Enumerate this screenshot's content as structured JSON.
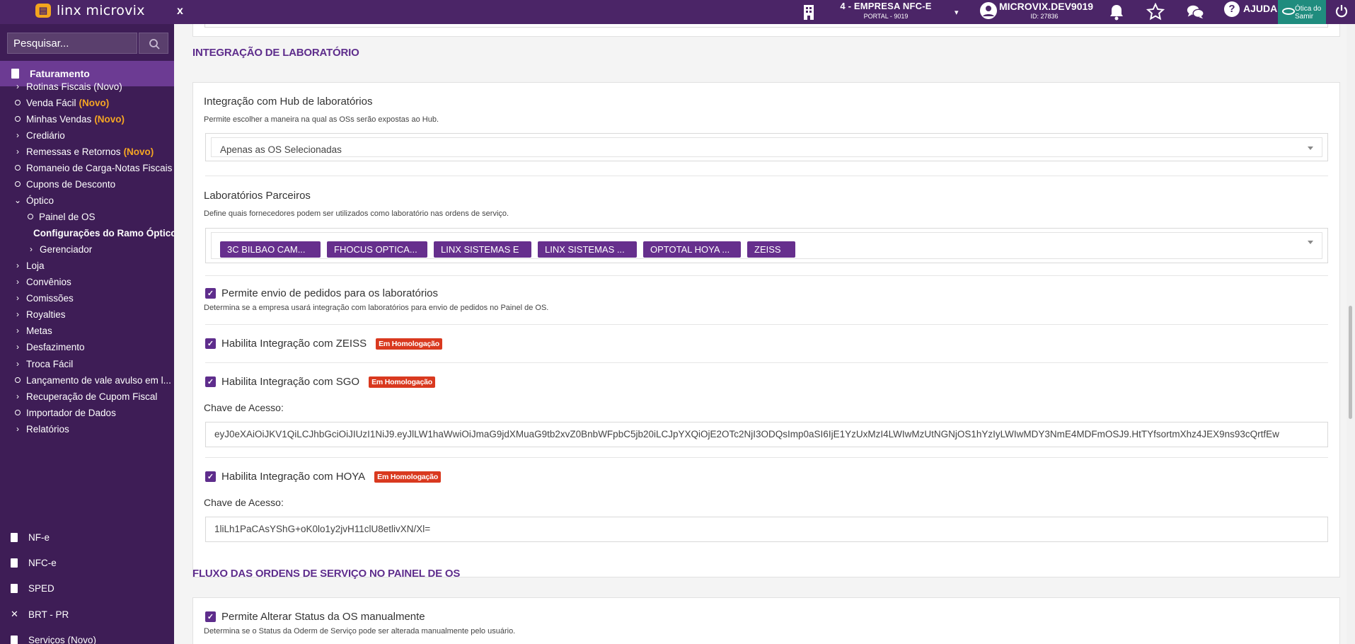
{
  "topbar": {
    "logo_text": "linx microvix",
    "close_label": "x",
    "company_name": "4 - EMPRESA NFC-E",
    "company_sub": "PORTAL - 9019",
    "company_caret": "▾",
    "user_name": "MICROVIX.DEV9019",
    "user_sub": "ID: 27836",
    "help_label": "AJUDA",
    "help_symbol": "?",
    "samir_label_1": "Ótica do",
    "samir_label_2": "Samir"
  },
  "sidebar": {
    "search_placeholder": "Pesquisar...",
    "section_header": "Faturamento",
    "items": [
      {
        "label": "Rotinas Fiscais (Novo)",
        "kind": "chev"
      },
      {
        "label": "Venda Fácil",
        "novo": "(Novo)",
        "kind": "circ"
      },
      {
        "label": "Minhas Vendas",
        "novo": "(Novo)",
        "kind": "circ"
      },
      {
        "label": "Crediário",
        "kind": "chev"
      },
      {
        "label": "Remessas e Retornos",
        "novo": "(Novo)",
        "kind": "chev"
      },
      {
        "label": "Romaneio de Carga-Notas Fiscais",
        "kind": "circ"
      },
      {
        "label": "Cupons de Desconto",
        "kind": "circ"
      },
      {
        "label": "Óptico",
        "kind": "chev-open"
      },
      {
        "label": "Painel de OS",
        "kind": "sub-circ"
      },
      {
        "label": "Configurações do Ramo Óptico",
        "kind": "sub-dot"
      },
      {
        "label": "Gerenciador",
        "kind": "sub-chev"
      },
      {
        "label": "Loja",
        "kind": "chev"
      },
      {
        "label": "Convênios",
        "kind": "chev"
      },
      {
        "label": "Comissões",
        "kind": "chev"
      },
      {
        "label": "Royalties",
        "kind": "chev"
      },
      {
        "label": "Metas",
        "kind": "chev"
      },
      {
        "label": "Desfazimento",
        "kind": "chev"
      },
      {
        "label": "Troca Fácil",
        "kind": "chev"
      },
      {
        "label": "Lançamento de vale avulso em l...",
        "kind": "circ"
      },
      {
        "label": "Recuperação de Cupom Fiscal",
        "kind": "chev"
      },
      {
        "label": "Importador de Dados",
        "kind": "circ"
      },
      {
        "label": "Relatórios",
        "kind": "chev"
      }
    ],
    "modules": [
      {
        "label": "NF-e",
        "icon": "doc"
      },
      {
        "label": "NFC-e",
        "icon": "doc"
      },
      {
        "label": "SPED",
        "icon": "doc"
      },
      {
        "label": "BRT - PR",
        "icon": "x"
      },
      {
        "label": "Serviços (Novo)",
        "icon": "doc"
      }
    ]
  },
  "main": {
    "lab_section_title": "INTEGRAÇÃO DE LABORATÓRIO",
    "hub": {
      "label": "Integração com Hub de laboratórios",
      "desc": "Permite escolher a maneira na qual as OSs serão expostas ao Hub.",
      "value": "Apenas as OS Selecionadas"
    },
    "partners": {
      "label": "Laboratórios Parceiros",
      "desc": "Define quais fornecedores podem ser utilizados como laboratório nas ordens de serviço.",
      "tags": [
        "3C BILBAO CAM...",
        "FHOCUS OPTICA...",
        "LINX SISTEMAS E",
        "LINX SISTEMAS ...",
        "OPTOTAL HOYA ...",
        "ZEISS"
      ]
    },
    "send_orders": {
      "label": "Permite envio de pedidos para os laboratórios",
      "desc": "Determina se a empresa usará integração com laboratórios para envio de pedidos no Painel de OS."
    },
    "zeiss": {
      "label": "Habilita Integração com ZEISS",
      "badge": "Em Homologação"
    },
    "sgo": {
      "label": "Habilita Integração com SGO",
      "badge": "Em Homologação",
      "key_label": "Chave de Acesso:",
      "key_value": "eyJ0eXAiOiJKV1QiLCJhbGciOiJIUzI1NiJ9.eyJlLW1haWwiOiJmaG9jdXMuaG9tb2xvZ0BnbWFpbC5jb20iLCJpYXQiOjE2OTc2NjI3ODQsImp0aSI6IjE1YzUxMzI4LWIwMzUtNGNjOS1hYzIyLWIwMDY3NmE4MDFmOSJ9.HtTYfsortmXhz4JEX9ns93cQrtfEw"
    },
    "hoya": {
      "label": "Habilita Integração com HOYA",
      "badge": "Em Homologação",
      "key_label": "Chave de Acesso:",
      "key_value": "1liLh1PaCAsYShG+oK0lo1y2jvH11clU8etlivXN/Xl="
    },
    "flow_section_title": "FLUXO DAS ORDENS DE SERVIÇO NO PAINEL DE OS",
    "alter_status": {
      "label": "Permite Alterar Status da OS manualmente",
      "desc": "Determina se o Status da Oderm de Serviço pode ser alterada manualmente pelo usuário."
    },
    "check_glyph": "✓"
  },
  "colors": {
    "topbar": "#4b2567",
    "sidebar": "#3e1d56",
    "accent": "#5e2d8c",
    "tag": "#662f8d",
    "badge": "#d9391f",
    "novo": "#f5a623"
  }
}
